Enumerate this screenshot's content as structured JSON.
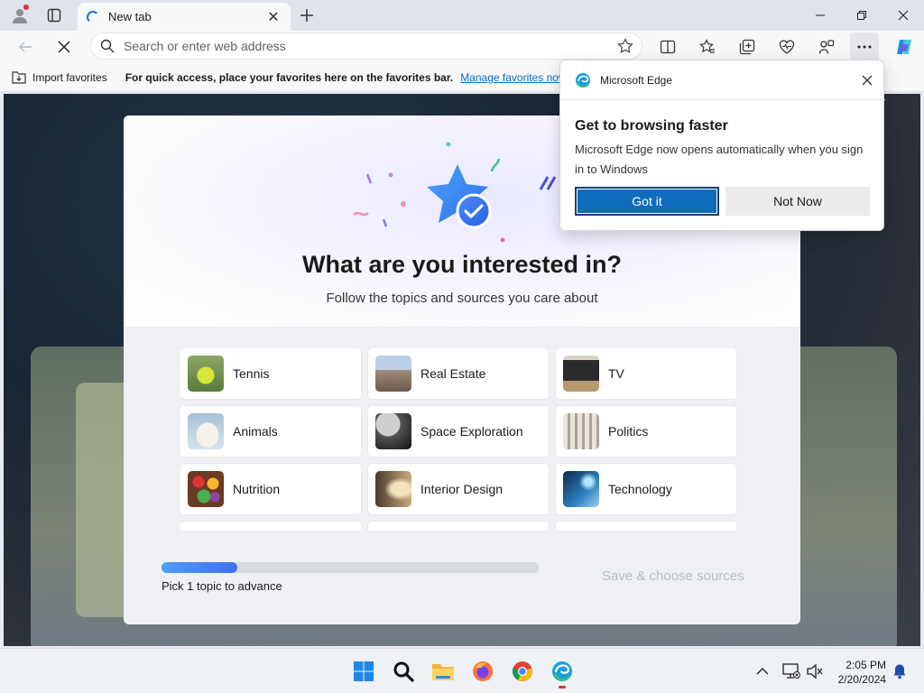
{
  "browser": {
    "tab": {
      "title": "New tab"
    },
    "omnibox": {
      "placeholder": "Search or enter web address"
    }
  },
  "favorites_bar": {
    "import_label": "Import favorites",
    "message": "For quick access, place your favorites here on the favorites bar.",
    "manage_link": "Manage favorites now"
  },
  "onboarding": {
    "title": "What are you interested in?",
    "subtitle": "Follow the topics and sources you care about",
    "topics": [
      {
        "label": "Tennis",
        "thumb": "tennis"
      },
      {
        "label": "Real Estate",
        "thumb": "real-estate"
      },
      {
        "label": "TV",
        "thumb": "tv"
      },
      {
        "label": "Animals",
        "thumb": "animals"
      },
      {
        "label": "Space Exploration",
        "thumb": "space"
      },
      {
        "label": "Politics",
        "thumb": "politics"
      },
      {
        "label": "Nutrition",
        "thumb": "nutrition"
      },
      {
        "label": "Interior Design",
        "thumb": "interior"
      },
      {
        "label": "Technology",
        "thumb": "technology"
      }
    ],
    "progress_fraction": 0.2,
    "progress_text": "Pick 1 topic to advance",
    "save_button": "Save & choose sources"
  },
  "popup": {
    "app_name": "Microsoft Edge",
    "title": "Get to browsing faster",
    "body": "Microsoft Edge now opens automatically when you sign in to Windows",
    "primary_button": "Got it",
    "secondary_button": "Not Now"
  },
  "taskbar": {
    "time": "2:05 PM",
    "date": "2/20/2024",
    "apps": [
      "windows-start-icon",
      "search-icon",
      "file-explorer-icon",
      "firefox-icon",
      "chrome-icon",
      "edge-icon"
    ]
  },
  "colors": {
    "accent": "#0f6cbd",
    "progress_start": "#4ea0f5",
    "progress_end": "#3f6df0",
    "notification_dot": "#d13438"
  }
}
